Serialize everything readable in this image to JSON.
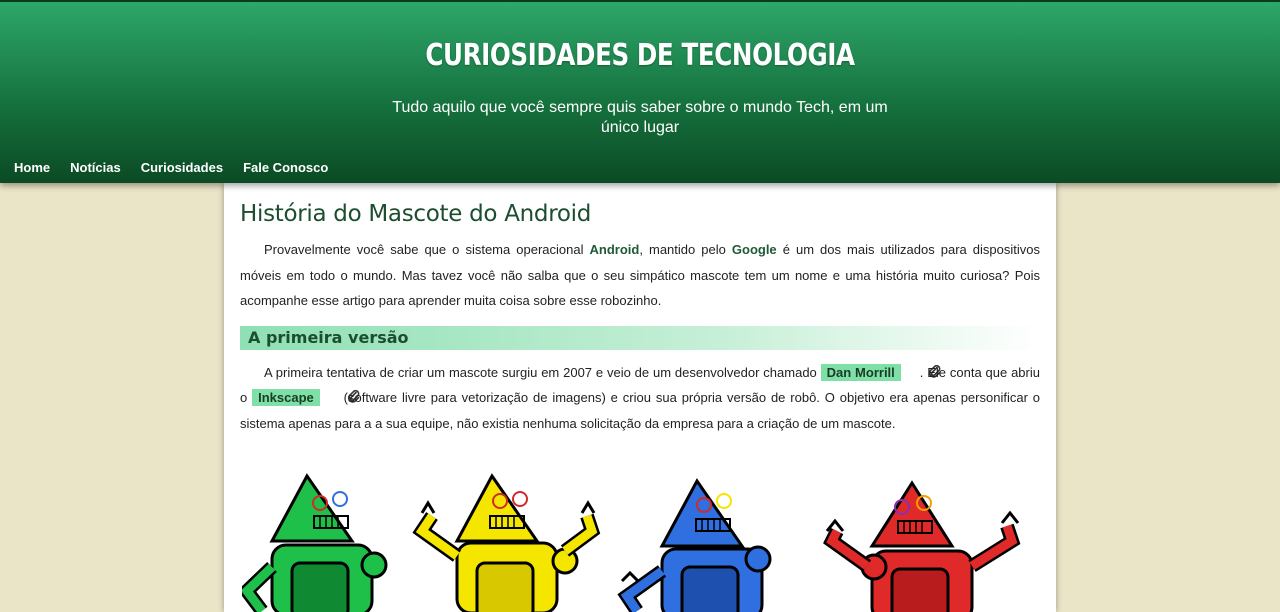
{
  "header": {
    "title": "CURIOSIDADES DE TECNOLOGIA",
    "subtitle": "Tudo aquilo que você sempre quis saber sobre o mundo Tech, em um único lugar"
  },
  "nav": {
    "items": [
      {
        "label": "Home"
      },
      {
        "label": "Notícias"
      },
      {
        "label": "Curiosidades"
      },
      {
        "label": "Fale Conosco"
      }
    ]
  },
  "article": {
    "title": "História do Mascote do Android",
    "intro": {
      "part1": "Provavelmente você sabe que o sistema operacional ",
      "android": "Android",
      "part2": ", mantido pelo ",
      "google": "Google",
      "part3": " é um dos mais utilizados para dispositivos móveis em todo o mundo. Mas tavez você não salba que o seu simpático mascote tem um nome e uma história muito curiosa? Pois acompanhe esse artigo para aprender muita coisa sobre esse robozinho."
    },
    "section1": {
      "heading": "A primeira versão",
      "part1": "A primeira tentativa de criar um mascote surgiu em 2007 e veio de um desenvolvedor chamado ",
      "dan": "Dan Morrill",
      "part2": ". Ele conta que abriu o ",
      "inkscape": "Inkscape",
      "part3": " (software livre para vetorização de imagens) e criou sua própria versão de robô. O objetivo era apenas personificar o sistema apenas para a a sua equipe, não existia nenhuma solicitação da empresa para a criação de um mascote."
    }
  },
  "colors": {
    "header_top": "#2ea86b",
    "header_bottom": "#0b4a24",
    "page_bg": "#ebe5c8",
    "highlight": "#7ee0a6",
    "robot_colors": [
      "#1fc04a",
      "#f5e600",
      "#2f6fe0",
      "#e02a2a"
    ]
  },
  "icons": {
    "link": "paperclip-link-icon"
  }
}
